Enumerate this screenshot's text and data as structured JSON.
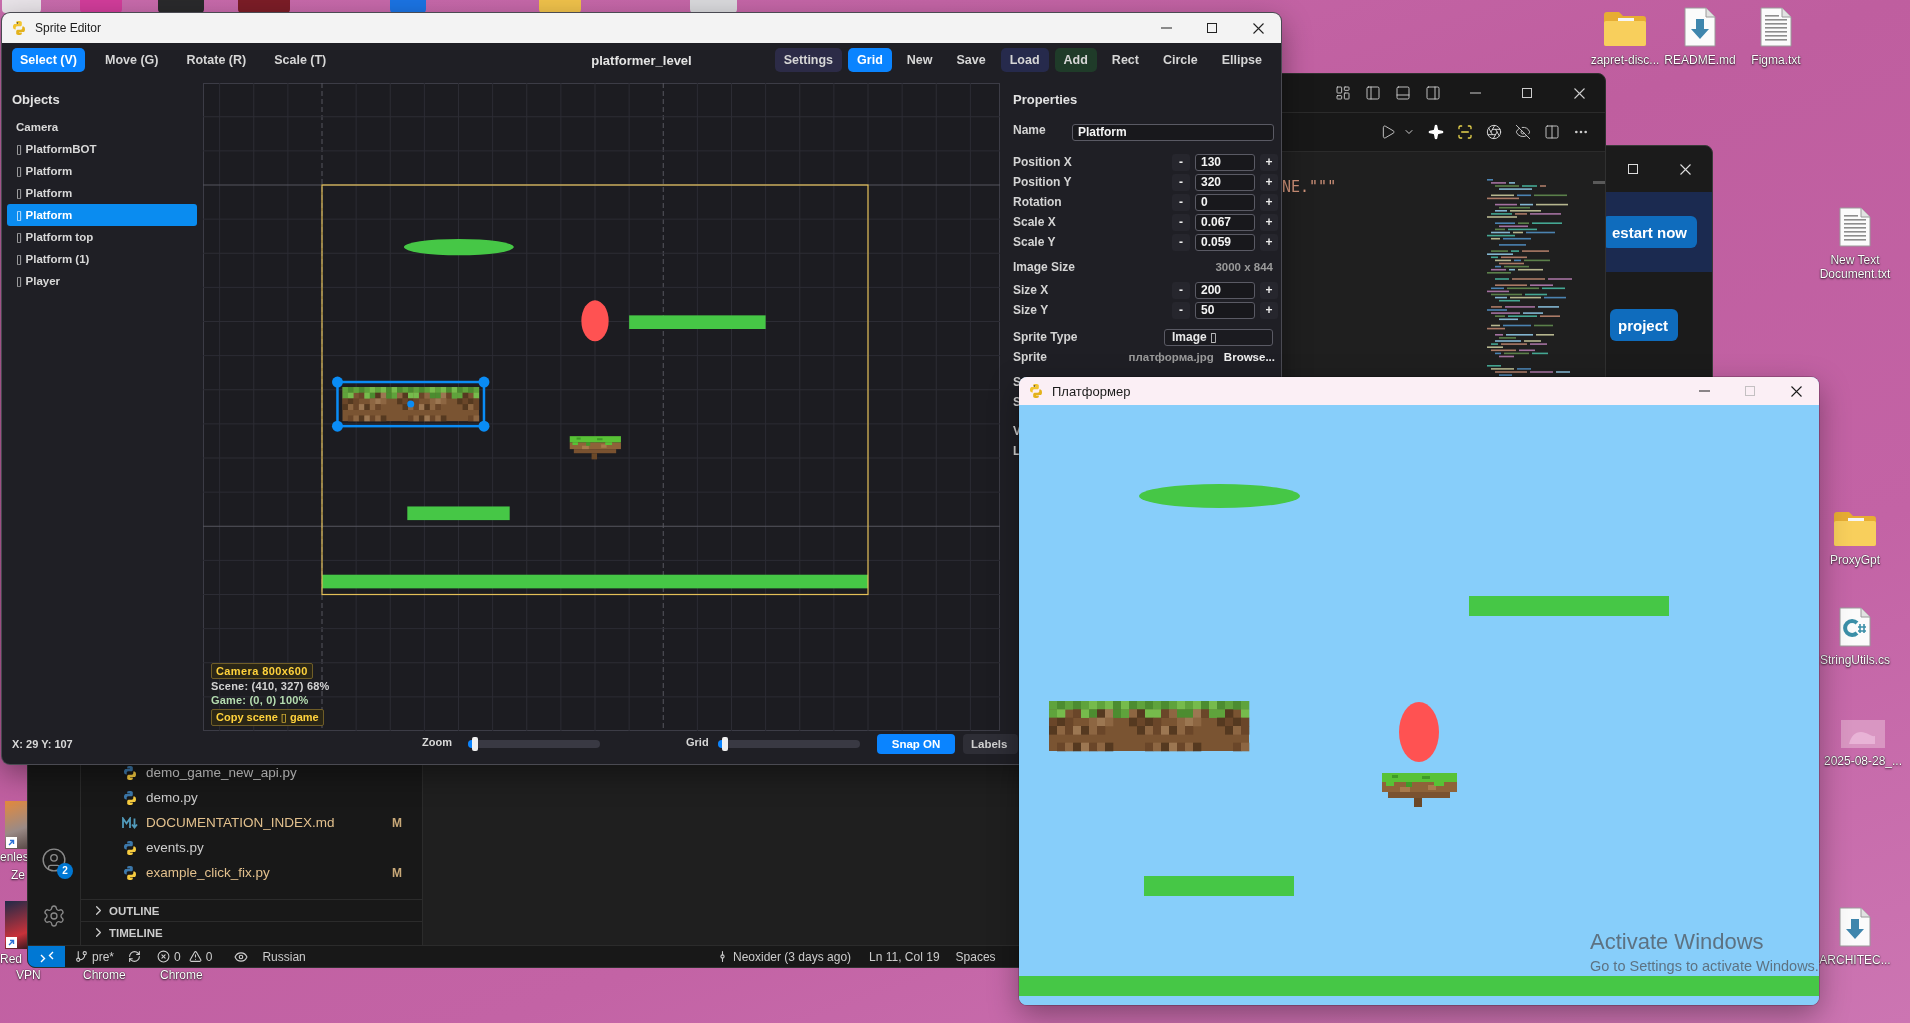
{
  "desktop": {
    "top_icons": [
      {
        "label": "zapret-disc...",
        "kind": "folder"
      },
      {
        "label": "README.md",
        "kind": "download"
      },
      {
        "label": "Figma.txt",
        "kind": "text"
      }
    ],
    "side_icons": [
      {
        "label": "New Text Document.txt",
        "kind": "text"
      },
      {
        "label": "ProxyGpt",
        "kind": "folder"
      },
      {
        "label": "StringUtils.cs",
        "kind": "csharp"
      },
      {
        "label": "2025-08-28_...",
        "kind": "image"
      },
      {
        "label": "ARCHITEC...",
        "kind": "download"
      }
    ],
    "left_shortcuts": [
      {
        "lines": [
          "enles",
          "Ze"
        ]
      },
      {
        "lines": [
          "Red",
          "VPN"
        ]
      }
    ],
    "labels_below_editor": [
      "Chrome",
      "Chrome"
    ]
  },
  "background_window": {
    "buttons": [
      "estart now",
      "project"
    ]
  },
  "code_editor": {
    "code_fragment": "NE.\"\"\"",
    "files": [
      {
        "name": "demo_game_new_api.py",
        "kind": "python"
      },
      {
        "name": "demo.py",
        "kind": "python"
      },
      {
        "name": "DOCUMENTATION_INDEX.md",
        "kind": "markdown",
        "badge": "M"
      },
      {
        "name": "events.py",
        "kind": "python"
      },
      {
        "name": "example_click_fix.py",
        "kind": "python",
        "badge": "M"
      }
    ],
    "sections": [
      {
        "label": "OUTLINE",
        "expanded": false
      },
      {
        "label": "TIMELINE",
        "expanded": false
      }
    ],
    "accounts_badge": "2",
    "status_bar": {
      "branch": "pre*",
      "errors": "0",
      "warnings": "0",
      "language": "Russian",
      "blame": "Neoxider (3 days ago)",
      "position": "Ln 11, Col 19",
      "indent": "Spaces"
    }
  },
  "sprite_editor": {
    "title": "Sprite Editor",
    "tools": [
      {
        "label": "Select (V)",
        "selected": true
      },
      {
        "label": "Move (G)",
        "selected": false
      },
      {
        "label": "Rotate (R)",
        "selected": false
      },
      {
        "label": "Scale (T)",
        "selected": false
      }
    ],
    "scene_name": "platformer_level",
    "actions": [
      {
        "label": "Settings",
        "kind": "action",
        "color": "#2c2b47"
      },
      {
        "label": "Grid",
        "kind": "toggle",
        "on": true
      },
      {
        "label": "New",
        "kind": "action"
      },
      {
        "label": "Save",
        "kind": "action"
      },
      {
        "label": "Load",
        "kind": "action",
        "color": "#262a4c"
      },
      {
        "label": "Add",
        "kind": "action",
        "color": "#1f3b29"
      },
      {
        "label": "Rect",
        "kind": "action"
      },
      {
        "label": "Circle",
        "kind": "action"
      },
      {
        "label": "Ellipse",
        "kind": "action"
      }
    ],
    "objects": {
      "title": "Objects",
      "items": [
        {
          "label": "Camera",
          "selected": false
        },
        {
          "label": "▯ PlatformBOT",
          "selected": false
        },
        {
          "label": "▯ Platform",
          "selected": false
        },
        {
          "label": "▯ Platform",
          "selected": false
        },
        {
          "label": "▯ Platform",
          "selected": true
        },
        {
          "label": "▯ Platform top",
          "selected": false
        },
        {
          "label": "▯ Platform (1)",
          "selected": false
        },
        {
          "label": "▯ Player",
          "selected": false
        }
      ]
    },
    "canvas": {
      "camera_label": "Camera 800x600",
      "scene_readout": "Scene: (410, 327) 68%",
      "game_readout": "Game: (0, 0) 100%",
      "copy_button": "Copy scene ▯ game"
    },
    "properties": {
      "title": "Properties",
      "name": {
        "label": "Name",
        "value": "Platform"
      },
      "transform": [
        {
          "label": "Position X",
          "value": "130",
          "minus": "-",
          "plus": "+"
        },
        {
          "label": "Position Y",
          "value": "320",
          "minus": "-",
          "plus": "+"
        },
        {
          "label": "Rotation",
          "value": "0",
          "minus": "-",
          "plus": "+"
        },
        {
          "label": "Scale X",
          "value": "0.067",
          "minus": "-",
          "plus": "+"
        },
        {
          "label": "Scale Y",
          "value": "0.059",
          "minus": "-",
          "plus": "+"
        }
      ],
      "image_size": {
        "label": "Image Size",
        "value": "3000 x 844"
      },
      "size": [
        {
          "label": "Size X",
          "value": "200",
          "minus": "-",
          "plus": "+"
        },
        {
          "label": "Size Y",
          "value": "50",
          "minus": "-",
          "plus": "+"
        }
      ],
      "sprite_type": {
        "label": "Sprite Type",
        "value": "Image ▯"
      },
      "sprite": {
        "label": "Sprite",
        "file": "платформа.jpg",
        "button": "Browse..."
      },
      "cut_labels": [
        "S",
        "S",
        "V",
        "L"
      ]
    },
    "status": {
      "cursor": "X: 29 Y: 107",
      "zoom": {
        "label": "Zoom",
        "level": 0.03
      },
      "grid": {
        "label": "Grid",
        "level": 0.03
      },
      "snap": {
        "label": "Snap ON",
        "on": true
      },
      "labels_button": "Labels"
    }
  },
  "game_window": {
    "title": "Платформер",
    "maximize_disabled": true
  },
  "activation_notice": {
    "title": "Activate Windows",
    "subtitle": "Go to Settings to activate Windows."
  }
}
